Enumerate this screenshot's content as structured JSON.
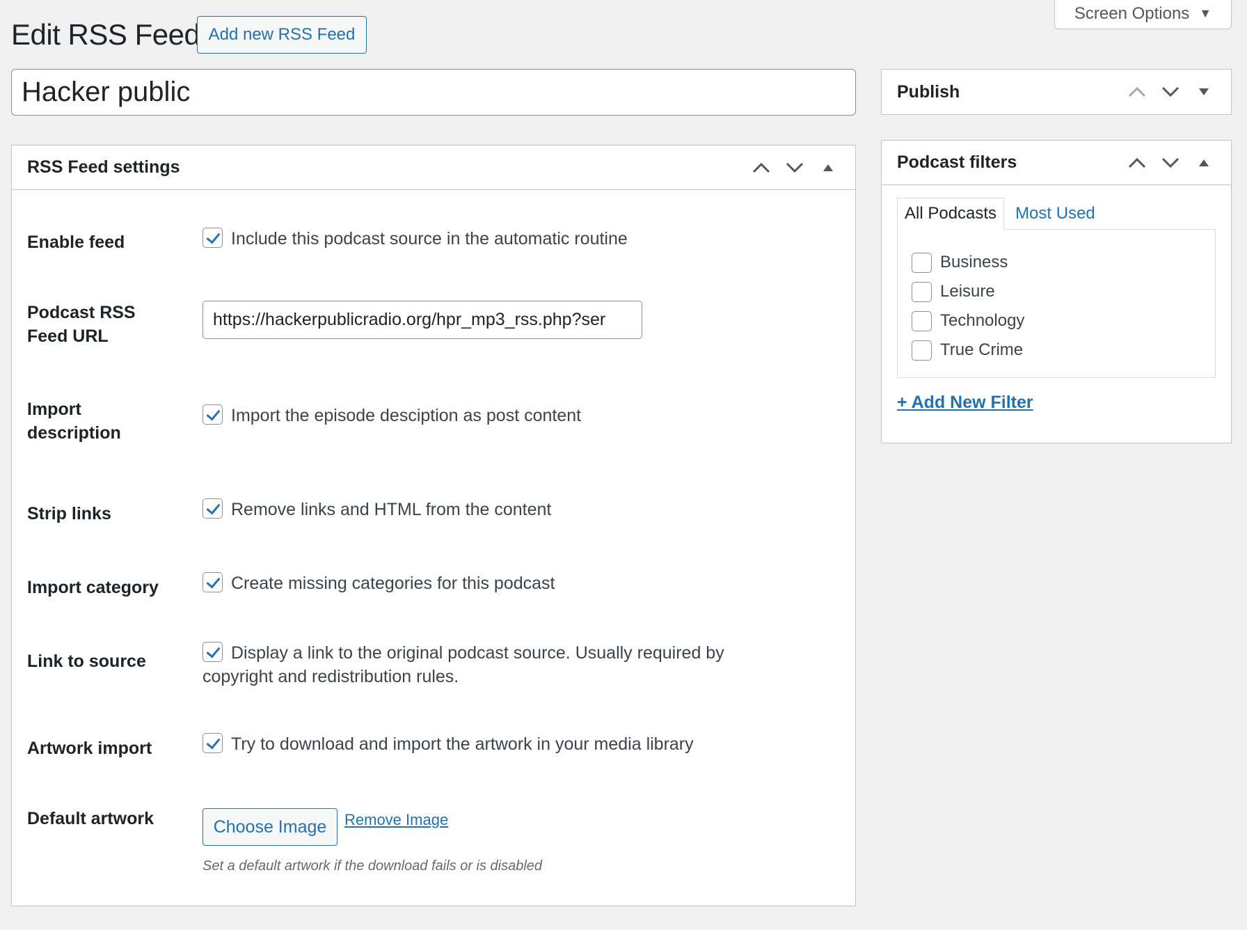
{
  "screen_options": {
    "label": "Screen Options",
    "caret": "▼"
  },
  "header": {
    "title": "Edit RSS Feed",
    "add_new_label": "Add new RSS Feed"
  },
  "post_title": {
    "value": "Hacker public"
  },
  "rss_settings": {
    "title": "RSS Feed settings",
    "rows": {
      "enable_feed": {
        "label": "Enable feed",
        "text": "Include this podcast source in the automatic routine",
        "checked": true
      },
      "feed_url": {
        "label": "Podcast RSS Feed URL",
        "value": "https://hackerpublicradio.org/hpr_mp3_rss.php?ser"
      },
      "import_description": {
        "label": "Import description",
        "text": "Import the episode desciption as post content",
        "checked": true
      },
      "strip_links": {
        "label": "Strip links",
        "text": "Remove links and HTML from the content",
        "checked": true
      },
      "import_category": {
        "label": "Import category",
        "text": "Create missing categories for this podcast",
        "checked": true
      },
      "link_to_source": {
        "label": "Link to source",
        "text": "Display a link to the original podcast source. Usually required by copyright and redistribution rules.",
        "checked": true
      },
      "artwork_import": {
        "label": "Artwork import",
        "text": "Try to download and import the artwork in your media library",
        "checked": true
      },
      "default_artwork": {
        "label": "Default artwork",
        "choose_label": "Choose Image",
        "remove_label": "Remove Image",
        "hint": "Set a default artwork if the download fails or is disabled"
      }
    }
  },
  "publish": {
    "title": "Publish"
  },
  "podcast_filters": {
    "title": "Podcast filters",
    "tabs": {
      "all": "All Podcasts",
      "most_used": "Most Used"
    },
    "items": [
      "Business",
      "Leisure",
      "Technology",
      "True Crime"
    ],
    "add_new_label": "+ Add New Filter"
  },
  "colors": {
    "accent": "#2271b1",
    "background": "#f0f0f1"
  },
  "icons": {
    "move_up": "chevron-up-icon",
    "move_down": "chevron-down-icon",
    "toggle": "triangle-up-icon"
  }
}
